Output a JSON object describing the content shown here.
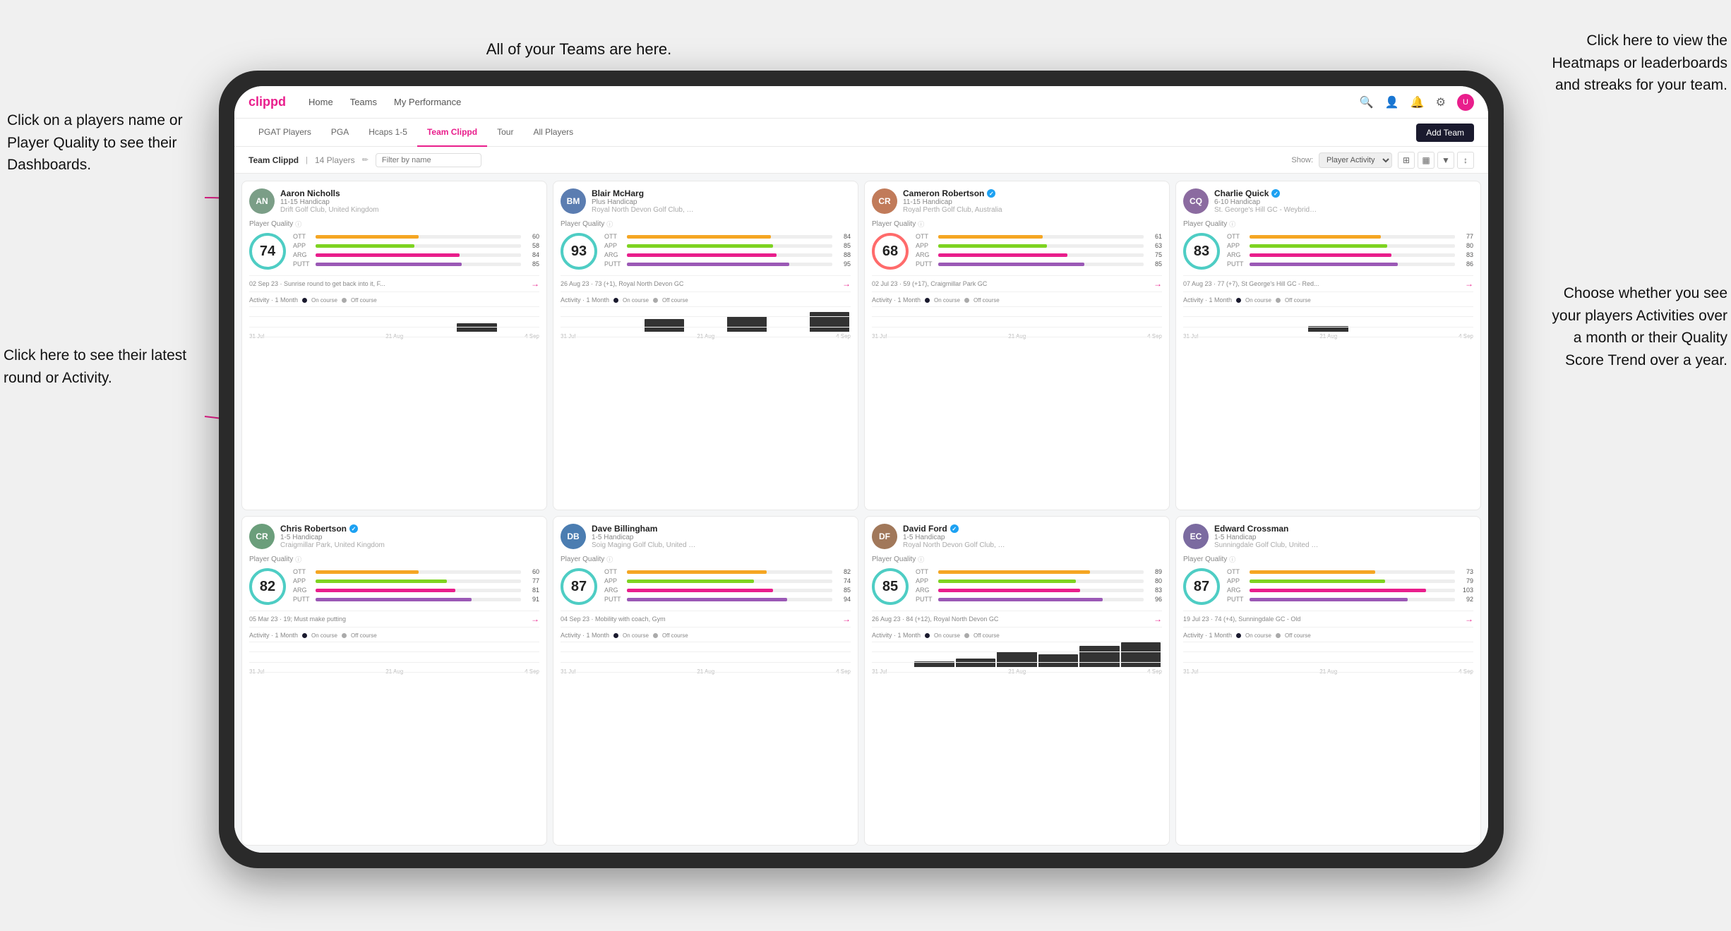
{
  "annotations": {
    "players_name": "Click on a players name\nor Player Quality to see\ntheir Dashboards.",
    "teams_here": "All of your Teams are here.",
    "heatmaps": "Click here to view the\nHeatmaps or leaderboards\nand streaks for your team.",
    "latest_round": "Click here to see their latest\nround or Activity.",
    "activities": "Choose whether you see\nyour players Activities over\na month or their Quality\nScore Trend over a year."
  },
  "nav": {
    "logo": "clippd",
    "items": [
      "Home",
      "Teams",
      "My Performance"
    ],
    "add_team_label": "Add Team"
  },
  "sub_nav": {
    "items": [
      "PGAT Players",
      "PGA",
      "Hcaps 1-5",
      "Team Clippd",
      "Tour",
      "All Players"
    ],
    "active": "Team Clippd"
  },
  "team_header": {
    "title": "Team Clippd",
    "count": "14 Players",
    "filter_placeholder": "Filter by name",
    "show_label": "Show:",
    "show_option": "Player Activity"
  },
  "players": [
    {
      "name": "Aaron Nicholls",
      "handicap": "11-15 Handicap",
      "club": "Drift Golf Club, United Kingdom",
      "quality": 74,
      "ott": 60,
      "app": 58,
      "arg": 84,
      "putt": 85,
      "latest_round": "02 Sep 23 · Sunrise round to get back into it, F...",
      "activity_label": "Activity · 1 Month",
      "color": "#4ECDC4",
      "initials": "AN",
      "avatar_color": "#7B9E87",
      "bars": [
        0,
        0,
        0,
        0,
        0,
        12,
        0
      ]
    },
    {
      "name": "Blair McHarg",
      "handicap": "Plus Handicap",
      "club": "Royal North Devon Golf Club, United Ki...",
      "quality": 93,
      "ott": 84,
      "app": 85,
      "arg": 88,
      "putt": 95,
      "latest_round": "26 Aug 23 · 73 (+1), Royal North Devon GC",
      "activity_label": "Activity · 1 Month",
      "color": "#4ECDC4",
      "initials": "BM",
      "avatar_color": "#5B7DB1",
      "bars": [
        0,
        0,
        18,
        0,
        22,
        0,
        28
      ]
    },
    {
      "name": "Cameron Robertson",
      "handicap": "11-15 Handicap",
      "club": "Royal Perth Golf Club, Australia",
      "quality": 68,
      "ott": 61,
      "app": 63,
      "arg": 75,
      "putt": 85,
      "latest_round": "02 Jul 23 · 59 (+17), Craigmillar Park GC",
      "activity_label": "Activity · 1 Month",
      "color": "#FF6B6B",
      "initials": "CR",
      "avatar_color": "#C17B5A",
      "bars": [
        0,
        0,
        0,
        0,
        0,
        0,
        0
      ],
      "verified": true
    },
    {
      "name": "Charlie Quick",
      "handicap": "6-10 Handicap",
      "club": "St. George's Hill GC - Weybridge - Surrey...",
      "quality": 83,
      "ott": 77,
      "app": 80,
      "arg": 83,
      "putt": 86,
      "latest_round": "07 Aug 23 · 77 (+7), St George's Hill GC - Red...",
      "activity_label": "Activity · 1 Month",
      "color": "#4ECDC4",
      "initials": "CQ",
      "avatar_color": "#8B6BA0",
      "bars": [
        0,
        0,
        0,
        8,
        0,
        0,
        0
      ],
      "verified": true
    },
    {
      "name": "Chris Robertson",
      "handicap": "1-5 Handicap",
      "club": "Craigmillar Park, United Kingdom",
      "quality": 82,
      "ott": 60,
      "app": 77,
      "arg": 81,
      "putt": 91,
      "latest_round": "05 Mar 23 · 19; Must make putting",
      "activity_label": "Activity · 1 Month",
      "color": "#4ECDC4",
      "initials": "CR",
      "avatar_color": "#7B9E87",
      "bars": [
        0,
        0,
        0,
        0,
        0,
        0,
        0
      ],
      "verified": true
    },
    {
      "name": "Dave Billingham",
      "handicap": "1-5 Handicap",
      "club": "Soig Maging Golf Club, United Kingdom",
      "quality": 87,
      "ott": 82,
      "app": 74,
      "arg": 85,
      "putt": 94,
      "latest_round": "04 Sep 23 · Mobility with coach, Gym",
      "activity_label": "Activity · 1 Month",
      "color": "#4ECDC4",
      "initials": "DB",
      "avatar_color": "#5B7DB1",
      "bars": [
        0,
        0,
        0,
        0,
        0,
        0,
        0
      ]
    },
    {
      "name": "David Ford",
      "handicap": "1-5 Handicap",
      "club": "Royal North Devon Golf Club, United Ki...",
      "quality": 85,
      "ott": 89,
      "app": 80,
      "arg": 83,
      "putt": 96,
      "latest_round": "26 Aug 23 · 84 (+12), Royal North Devon GC",
      "activity_label": "Activity · 1 Month",
      "color": "#4ECDC4",
      "initials": "DF",
      "avatar_color": "#C17B5A",
      "bars": [
        0,
        8,
        12,
        22,
        18,
        30,
        35
      ],
      "verified": true
    },
    {
      "name": "Edward Crossman",
      "handicap": "1-5 Handicap",
      "club": "Sunningdale Golf Club, United Kingdom",
      "quality": 87,
      "ott": 73,
      "app": 79,
      "arg": 103,
      "putt": 92,
      "latest_round": "19 Jul 23 · 74 (+4), Sunningdale GC - Old",
      "activity_label": "Activity · 1 Month",
      "color": "#4ECDC4",
      "initials": "EC",
      "avatar_color": "#8B6BA0",
      "bars": [
        0,
        0,
        0,
        0,
        0,
        0,
        0
      ]
    }
  ]
}
